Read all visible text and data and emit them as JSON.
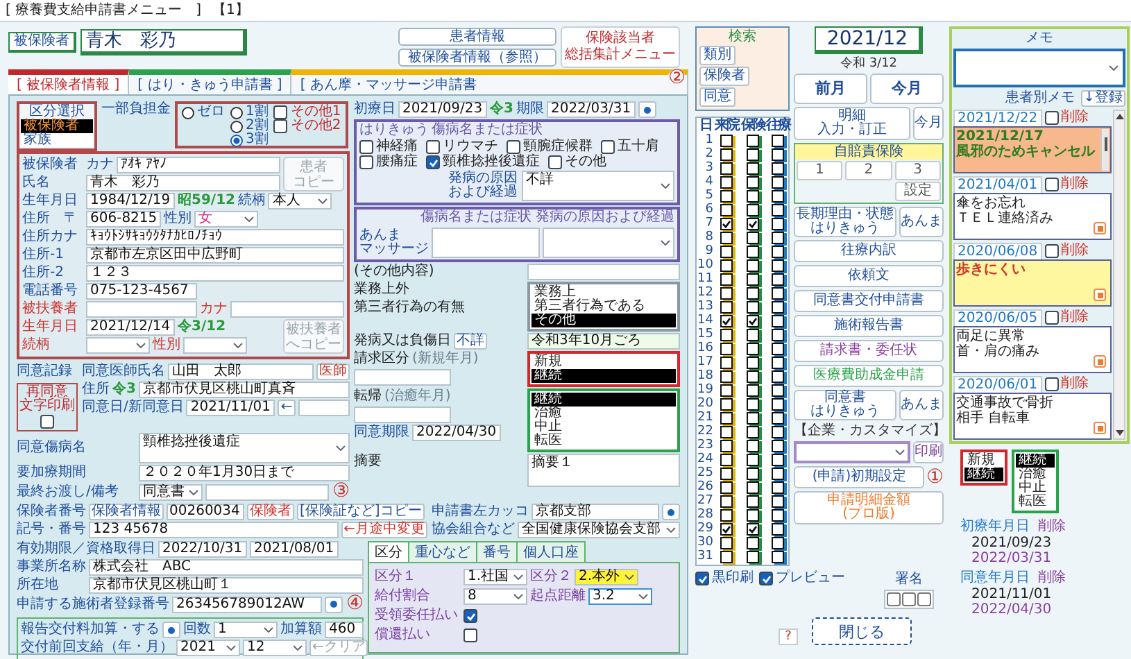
{
  "window": {
    "title": "[ 療養費支給申請書メニュー　]",
    "number": "【1】"
  },
  "patient": {
    "label": "被保険者",
    "name": "青木　彩乃"
  },
  "info_buttons": [
    "患者情報",
    "被保険者情報（参照）"
  ],
  "summary_button": {
    "lines": [
      "保険該当者",
      "総括集計メニュー"
    ],
    "marker": "②"
  },
  "tabs": [
    {
      "label": "[ 被保険者情報 ]",
      "selected": true,
      "color": "#c0282d"
    },
    {
      "label": "[ はり・きゅう申請書 ]",
      "selected": false,
      "color": "#2ca24c"
    },
    {
      "label": "[ あん摩・マッサージ申請書",
      "selected": false,
      "color": "#f0b400"
    }
  ],
  "category": {
    "title": "区分選択",
    "options": [
      {
        "label": "被保険者",
        "selected": true
      },
      {
        "label": "家族",
        "selected": false
      }
    ]
  },
  "copay": {
    "label": "一部負担金",
    "radios": [
      {
        "label": "ゼロ",
        "selected": false
      },
      {
        "label": "1割",
        "selected": false
      },
      {
        "label": "2割",
        "selected": false
      },
      {
        "label": "3割",
        "selected": true
      }
    ],
    "checks": [
      {
        "label": "その他1",
        "checked": false
      },
      {
        "label": "その他2",
        "checked": false
      }
    ]
  },
  "insured": {
    "groups": [
      {
        "rows": [
          {
            "items": [
              {
                "kind": "label",
                "text": "被保険者"
              },
              {
                "kind": "label",
                "text": "カナ"
              },
              {
                "kind": "field",
                "value": "ｱｵｷ ｱﾔﾉ"
              }
            ]
          },
          {
            "items": [
              {
                "kind": "label",
                "text": "氏名"
              },
              {
                "kind": "field",
                "value": "青木　彩乃"
              }
            ]
          }
        ],
        "button": {
          "lines": [
            "患者",
            "コピー"
          ],
          "disabled": true
        }
      },
      {
        "rows": [
          {
            "items": [
              {
                "kind": "label",
                "text": "生年月日"
              },
              {
                "kind": "date",
                "value": "1984/12/19"
              },
              {
                "kind": "era",
                "text": "昭59/12"
              },
              {
                "kind": "label",
                "text": "続柄"
              },
              {
                "kind": "select",
                "value": "本人"
              }
            ]
          },
          {
            "items": [
              {
                "kind": "label",
                "text": "住所　〒"
              },
              {
                "kind": "zip",
                "value": "606-8215"
              },
              {
                "kind": "label",
                "text": "性別"
              },
              {
                "kind": "select",
                "value": "女",
                "color": "#e0208a"
              }
            ]
          },
          {
            "items": [
              {
                "kind": "label",
                "text": "住所カナ"
              },
              {
                "kind": "field",
                "value": "ｷｮｳﾄｼｻｷｮｳｸﾀﾅｶﾋﾛﾉﾁｮｳ"
              }
            ]
          },
          {
            "items": [
              {
                "kind": "label",
                "text": "住所-1"
              },
              {
                "kind": "field",
                "value": "京都市左京区田中広野町"
              }
            ]
          },
          {
            "items": [
              {
                "kind": "label",
                "text": "住所-2"
              },
              {
                "kind": "field",
                "value": "１２３"
              }
            ]
          },
          {
            "items": [
              {
                "kind": "label",
                "text": "電話番号"
              },
              {
                "kind": "short",
                "value": "075-123-4567"
              }
            ]
          },
          {
            "items": [
              {
                "kind": "label",
                "text": "被扶養者",
                "color": "#d0342c"
              },
              {
                "kind": "short"
              },
              {
                "kind": "label",
                "text": "カナ",
                "color": "#d0342c"
              },
              {
                "kind": "field"
              }
            ]
          }
        ]
      },
      {
        "rows": [
          {
            "items": [
              {
                "kind": "label",
                "text": "生年月日",
                "color": "#d0342c"
              },
              {
                "kind": "date",
                "value": "2021/12/14"
              },
              {
                "kind": "era",
                "text": "令3/12"
              }
            ]
          },
          {
            "items": [
              {
                "kind": "label",
                "text": "続柄",
                "color": "#d0342c"
              },
              {
                "kind": "select"
              },
              {
                "kind": "label",
                "text": "性別",
                "color": "#d0342c"
              },
              {
                "kind": "select"
              }
            ]
          }
        ],
        "button": {
          "lines": [
            "被扶養者",
            "へコピー"
          ],
          "disabled": true
        }
      }
    ]
  },
  "consent": {
    "side_label": "同意記録",
    "reprint": {
      "lines": [
        "再同意",
        "文字印刷"
      ],
      "checked": false
    },
    "top_rows": [
      {
        "items": [
          {
            "kind": "label",
            "text": "同意医師氏名"
          },
          {
            "kind": "field",
            "value": "山田　太郎"
          },
          {
            "kind": "button",
            "text": "医師",
            "color": "#d0342c"
          }
        ]
      },
      {
        "items": [
          {
            "kind": "label",
            "text": "住所"
          },
          {
            "kind": "era",
            "text": "令3"
          },
          {
            "kind": "field",
            "value": "京都市伏見区桃山町真斉"
          }
        ]
      },
      {
        "items": [
          {
            "kind": "label",
            "text": "同意日/新同意日"
          },
          {
            "kind": "date",
            "value": "2021/11/01"
          },
          {
            "kind": "button",
            "text": "←"
          },
          {
            "kind": "field"
          }
        ]
      }
    ],
    "rows": [
      {
        "items": [
          {
            "kind": "label",
            "text": "同意傷病名"
          },
          {
            "kind": "box",
            "value": "頸椎捻挫後遺症"
          }
        ]
      },
      {
        "items": [
          {
            "kind": "label",
            "text": "要加療期間"
          },
          {
            "kind": "field",
            "value": "２０２０年1月30日まで"
          }
        ]
      },
      {
        "items": [
          {
            "kind": "label",
            "text": "最終お渡し/備考"
          },
          {
            "kind": "select",
            "value": "同意書"
          },
          {
            "kind": "field"
          },
          {
            "kind": "marker",
            "text": "③"
          }
        ]
      }
    ]
  },
  "first_visit": {
    "items": [
      {
        "kind": "label",
        "text": "初療日"
      },
      {
        "kind": "date",
        "value": "2021/09/23"
      },
      {
        "kind": "era",
        "text": "令3"
      },
      {
        "kind": "label",
        "text": "期限"
      },
      {
        "kind": "date",
        "value": "2022/03/31"
      },
      {
        "kind": "dot"
      }
    ]
  },
  "shinkyu": {
    "title": "はりきゅう",
    "subtitle": "傷病名または症状",
    "conditions": [
      {
        "label": "神経痛",
        "checked": false
      },
      {
        "label": "リウマチ",
        "checked": false
      },
      {
        "label": "頸腕症候群",
        "checked": false
      },
      {
        "label": "五十肩",
        "checked": false
      },
      {
        "label": "腰痛症",
        "checked": false
      },
      {
        "label": "頸椎捻挫後遺症",
        "checked": true
      },
      {
        "label": "その他",
        "checked": false
      }
    ],
    "cause_label": [
      "発病の原因",
      "および経過"
    ],
    "cause": "不詳"
  },
  "anma": {
    "headers": [
      "傷病名または症状",
      "発病の原因および経過"
    ],
    "side_label": [
      "あんま",
      "マッサージ"
    ]
  },
  "other_content": {
    "label": "(その他内容)"
  },
  "work": {
    "labels": [
      "業務上外",
      "第三者行為の有無"
    ],
    "options": [
      {
        "label": "業務上",
        "selected": false
      },
      {
        "label": "第三者行為である",
        "selected": false
      },
      {
        "label": "その他",
        "selected": true
      }
    ]
  },
  "onset": {
    "label": "発病又は負傷日",
    "button": "不詳",
    "value": "令和3年10月ごろ"
  },
  "claim": {
    "label": "請求区分",
    "note": "(新規年月)",
    "options": [
      {
        "label": "新規",
        "selected": false
      },
      {
        "label": "継続",
        "selected": true
      }
    ]
  },
  "outcome": {
    "label": "転帰",
    "note": "(治癒年月)",
    "expiry_label": "同意期限",
    "expiry": "2022/04/30",
    "options": [
      {
        "label": "継続",
        "selected": true
      },
      {
        "label": "治癒",
        "selected": false
      },
      {
        "label": "中止",
        "selected": false
      },
      {
        "label": "転医",
        "selected": false
      }
    ]
  },
  "remarks": {
    "label": "摘要",
    "value": "摘要１"
  },
  "insurer": {
    "rows": [
      {
        "items": [
          {
            "kind": "label",
            "text": "保険者番号"
          },
          {
            "kind": "button",
            "text": "保険者情報"
          },
          {
            "kind": "code",
            "value": "00260034"
          },
          {
            "kind": "button",
            "text": "保険者",
            "color": "#d0342c"
          },
          {
            "kind": "button",
            "text": "[保険証など]コピー"
          }
        ]
      },
      {
        "items": [
          {
            "kind": "label",
            "text": "記号・番号"
          },
          {
            "kind": "field",
            "value": "123 45678"
          },
          {
            "kind": "button",
            "text": "←月途中変更",
            "color": "#d0342c"
          }
        ]
      }
    ]
  },
  "bracket": {
    "rows": [
      {
        "items": [
          {
            "kind": "label",
            "text": "申請書左カッコ"
          },
          {
            "kind": "field",
            "value": "京都支部"
          },
          {
            "kind": "dot"
          }
        ]
      },
      {
        "items": [
          {
            "kind": "label",
            "text": "協会組合など"
          },
          {
            "kind": "combo",
            "value": "全国健康保険協会支部"
          }
        ]
      }
    ]
  },
  "office": {
    "rows": [
      {
        "items": [
          {
            "kind": "label",
            "text": "有効期限／資格取得日"
          },
          {
            "kind": "date",
            "value": "2022/10/31"
          },
          {
            "kind": "date",
            "value": "2021/08/01"
          }
        ]
      },
      {
        "items": [
          {
            "kind": "label",
            "text": "事業所名称"
          },
          {
            "kind": "field",
            "value": "株式会社　ABC"
          }
        ]
      },
      {
        "items": [
          {
            "kind": "label",
            "text": "所在地"
          },
          {
            "kind": "field",
            "value": "京都市伏見区桃山町１"
          }
        ]
      },
      {
        "items": [
          {
            "kind": "label",
            "text": "申請する施術者登録番号"
          },
          {
            "kind": "field",
            "value": "263456789012AW"
          },
          {
            "kind": "dot"
          },
          {
            "kind": "marker",
            "text": "④"
          }
        ]
      }
    ]
  },
  "report": {
    "rows": [
      {
        "items": [
          {
            "kind": "label",
            "text": "報告交付料加算・する"
          },
          {
            "kind": "toggle",
            "on": true
          },
          {
            "kind": "label",
            "text": "回数"
          },
          {
            "kind": "select",
            "value": "1"
          },
          {
            "kind": "label",
            "text": "加算額"
          },
          {
            "kind": "num",
            "value": "460"
          }
        ]
      },
      {
        "items": [
          {
            "kind": "label",
            "text": "交付前回支給（年・月）"
          },
          {
            "kind": "select",
            "value": "2021"
          },
          {
            "kind": "select",
            "value": "12"
          },
          {
            "kind": "button",
            "text": "←クリア",
            "disabled": true
          }
        ]
      }
    ]
  },
  "division": {
    "tabs": [
      {
        "label": "区分",
        "selected": true
      },
      {
        "label": "重心など",
        "selected": false
      },
      {
        "label": "番号",
        "selected": false
      },
      {
        "label": "個人口座",
        "selected": false
      }
    ],
    "rows": [
      {
        "items": [
          {
            "kind": "label",
            "text": "区分１",
            "color": "#7a3fa0"
          },
          {
            "kind": "select",
            "value": "1.社国"
          },
          {
            "kind": "label",
            "text": "区分２",
            "color": "#7a3fa0"
          },
          {
            "kind": "select",
            "value": "2.本外",
            "highlight": true
          }
        ]
      },
      {
        "items": [
          {
            "kind": "label",
            "text": "給付割合",
            "color": "#7a3fa0"
          },
          {
            "kind": "select",
            "value": "8"
          },
          {
            "kind": "label",
            "text": "起点距離",
            "color": "#7a3fa0"
          },
          {
            "kind": "select",
            "value": "3.2",
            "focused": true
          }
        ]
      },
      {
        "items": [
          {
            "kind": "label",
            "text": "受領委任払い",
            "color": "#7a3fa0"
          },
          {
            "kind": "check",
            "checked": true
          }
        ]
      },
      {
        "items": [
          {
            "kind": "label",
            "text": "償還払い",
            "color": "#7a3fa0"
          },
          {
            "kind": "check",
            "checked": false
          }
        ]
      }
    ]
  },
  "search": {
    "title": "検索",
    "buttons": [
      "類別",
      "保険者",
      "同意"
    ]
  },
  "days": {
    "headers": [
      "日",
      "来院",
      "保険",
      "往療"
    ],
    "rows": [
      {
        "day": "1",
        "visit": false,
        "insurance": false,
        "housecall": false
      },
      {
        "day": "2",
        "visit": false,
        "insurance": false,
        "housecall": false
      },
      {
        "day": "3",
        "visit": false,
        "insurance": false,
        "housecall": false
      },
      {
        "day": "4",
        "visit": false,
        "insurance": false,
        "housecall": false
      },
      {
        "day": "5",
        "visit": false,
        "insurance": false,
        "housecall": false
      },
      {
        "day": "6",
        "visit": false,
        "insurance": false,
        "housecall": false
      },
      {
        "day": "7",
        "visit": true,
        "insurance": true,
        "housecall": false
      },
      {
        "day": "8",
        "visit": false,
        "insurance": false,
        "housecall": false
      },
      {
        "day": "9",
        "visit": false,
        "insurance": false,
        "housecall": false
      },
      {
        "day": "10",
        "visit": false,
        "insurance": false,
        "housecall": false
      },
      {
        "day": "11",
        "visit": false,
        "insurance": false,
        "housecall": false
      },
      {
        "day": "12",
        "visit": false,
        "insurance": false,
        "housecall": false
      },
      {
        "day": "13",
        "visit": false,
        "insurance": false,
        "housecall": false
      },
      {
        "day": "14",
        "visit": true,
        "insurance": true,
        "housecall": false
      },
      {
        "day": "15",
        "visit": false,
        "insurance": false,
        "housecall": false
      },
      {
        "day": "16",
        "visit": false,
        "insurance": false,
        "housecall": false
      },
      {
        "day": "17",
        "visit": false,
        "insurance": false,
        "housecall": false
      },
      {
        "day": "18",
        "visit": false,
        "insurance": false,
        "housecall": false
      },
      {
        "day": "19",
        "visit": false,
        "insurance": false,
        "housecall": false
      },
      {
        "day": "20",
        "visit": false,
        "insurance": false,
        "housecall": false
      },
      {
        "day": "21",
        "visit": false,
        "insurance": false,
        "housecall": false
      },
      {
        "day": "22",
        "visit": false,
        "insurance": false,
        "housecall": false
      },
      {
        "day": "23",
        "visit": false,
        "insurance": false,
        "housecall": false
      },
      {
        "day": "24",
        "visit": false,
        "insurance": false,
        "housecall": false
      },
      {
        "day": "25",
        "visit": false,
        "insurance": false,
        "housecall": false
      },
      {
        "day": "26",
        "visit": false,
        "insurance": false,
        "housecall": false
      },
      {
        "day": "27",
        "visit": false,
        "insurance": false,
        "housecall": false
      },
      {
        "day": "28",
        "visit": false,
        "insurance": false,
        "housecall": false
      },
      {
        "day": "29",
        "visit": true,
        "insurance": true,
        "housecall": false
      },
      {
        "day": "30",
        "visit": false,
        "insurance": false,
        "housecall": false
      },
      {
        "day": "31",
        "visit": false,
        "insurance": false,
        "housecall": false
      }
    ]
  },
  "month": {
    "value": "2021/12",
    "era": "令和 3/12",
    "buttons": [
      "前月",
      "今月"
    ]
  },
  "detail": {
    "lines": [
      "明細",
      "入力・訂正"
    ],
    "button": "今月"
  },
  "jibaiseki": {
    "title": "自賠責保険",
    "buttons": [
      "1",
      "2",
      "3"
    ],
    "settings": "設定"
  },
  "reason_buttons": [
    {
      "lines": [
        "長期理由・状態",
        "はりきゅう"
      ]
    },
    {
      "lines": [
        "あんま"
      ]
    }
  ],
  "doc_buttons": [
    {
      "label": "往療内訳",
      "color": "#1f4e9c"
    },
    {
      "label": "依頼文",
      "color": "#1f4e9c"
    },
    {
      "label": "同意書交付申請書",
      "color": "#1f4e9c"
    },
    {
      "label": "施術報告書",
      "color": "#1f4e9c"
    },
    {
      "label": "請求書・委任状",
      "color": "#8a3fa0"
    },
    {
      "label": "医療費助成金申請",
      "color": "#2aa34a"
    }
  ],
  "consent_buttons": [
    {
      "lines": [
        "同意書",
        "はりきゅう"
      ]
    },
    {
      "lines": [
        "あんま"
      ]
    }
  ],
  "custom": {
    "label": "【企業・カスタマイズ】",
    "print": "印刷"
  },
  "init_button": {
    "label": "(申請)初期設定",
    "marker": "①"
  },
  "amount_button": {
    "lines": [
      "申請明細金額",
      "(プロ版)"
    ]
  },
  "print_options": [
    {
      "label": "黒印刷",
      "checked": true
    },
    {
      "label": "プレビュー",
      "checked": true
    }
  ],
  "signature": {
    "label": "署名"
  },
  "help": "?",
  "close": "閉じる",
  "memo": {
    "title": "メモ",
    "patient_label": "患者別メモ",
    "register": "↓登録",
    "entries": [
      {
        "date": "2021/12/22",
        "delete": "削除",
        "checked": false,
        "color": "#f6b88c",
        "kind": "scroll",
        "note": {
          "lines": [
            "2021/12/17",
            "風邪のためキャンセル"
          ],
          "color": "#2e7d1e",
          "bold": true
        }
      },
      {
        "date": "2021/04/01",
        "delete": "削除",
        "checked": false,
        "color": "#ffffff",
        "kind": "plain",
        "note": {
          "lines": [
            "傘をお忘れ",
            "ＴＥＬ連絡済み"
          ],
          "color": "#222222",
          "bold": false
        }
      },
      {
        "date": "2020/06/08",
        "delete": "削除",
        "checked": false,
        "color": "#fff7a0",
        "kind": "plain",
        "note": {
          "lines": [
            "歩きにくい"
          ],
          "color": "#d0342c",
          "bold": true
        }
      },
      {
        "date": "2020/06/05",
        "delete": "削除",
        "checked": false,
        "color": "#ffffff",
        "kind": "plain",
        "note": {
          "lines": [
            "両足に異常",
            "首・肩の痛み"
          ],
          "color": "#222222",
          "bold": false
        }
      },
      {
        "date": "2020/06/01",
        "delete": "削除",
        "checked": false,
        "color": "#ffffff",
        "kind": "plain",
        "note": {
          "lines": [
            "交通事故で骨折",
            "相手 自転車"
          ],
          "color": "#222222",
          "bold": false
        }
      }
    ],
    "status": {
      "claim": [
        {
          "label": "新規",
          "selected": false
        },
        {
          "label": "継続",
          "selected": true
        }
      ],
      "outcome": [
        {
          "label": "継続",
          "selected": true
        },
        {
          "label": "治癒",
          "selected": false
        },
        {
          "label": "中止",
          "selected": false
        },
        {
          "label": "転医",
          "selected": false
        }
      ],
      "dates": [
        {
          "label": "初療年月日",
          "delete": "削除",
          "values": [
            "2021/09/23",
            "2022/03/31"
          ]
        },
        {
          "label": "同意年月日",
          "delete": "削除",
          "values": [
            "2021/11/01",
            "2022/04/30"
          ]
        }
      ]
    }
  }
}
